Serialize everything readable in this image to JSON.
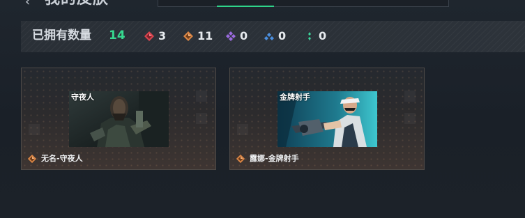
{
  "header": {
    "back_icon": "back-arrow-icon",
    "title": "我的皮肤"
  },
  "collection": {
    "label": "已拥有数量",
    "total": "14",
    "rarities": [
      {
        "icon": "red-gem-icon",
        "color": "#e0454f",
        "count": "3"
      },
      {
        "icon": "orange-gem-icon",
        "color": "#e2894a",
        "count": "11"
      },
      {
        "icon": "purple-gem-icon",
        "color": "#9b6be0",
        "count": "0"
      },
      {
        "icon": "blue-gem-icon",
        "color": "#4a8fe0",
        "count": "0"
      },
      {
        "icon": "green-gem-icon",
        "color": "#3ad49a",
        "count": "0"
      }
    ]
  },
  "skins": [
    {
      "name": "无名-守夜人",
      "rarity_icon": "orange-gem-icon",
      "thumb_logo": "守夜人"
    },
    {
      "name": "露娜-金牌射手",
      "rarity_icon": "orange-gem-icon",
      "thumb_logo": "金牌射手"
    }
  ]
}
